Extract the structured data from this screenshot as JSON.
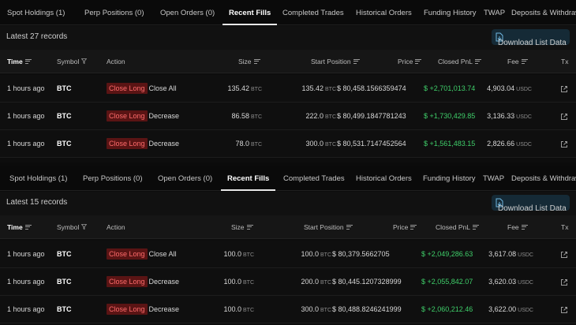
{
  "tabs": [
    "Spot Holdings (1)",
    "Perp Positions (0)",
    "Open Orders (0)",
    "Recent Fills",
    "Completed Trades",
    "Historical Orders",
    "Funding History",
    "TWAP",
    "Deposits & Withdraw"
  ],
  "active_tab": "Recent Fills",
  "download_label": "Download List Data",
  "columns": {
    "time": "Time",
    "symbol": "Symbol",
    "action": "Action",
    "size": "Size",
    "start_position": "Start Position",
    "price": "Price",
    "closed_pnl": "Closed PnL",
    "fee": "Fee",
    "tx": "Tx"
  },
  "panels": [
    {
      "records_label": "Latest 27 records",
      "rows": [
        {
          "time": "1 hours ago",
          "symbol": "BTC",
          "action_badge": "Close Long",
          "action_text": "Close All",
          "size": "135.42",
          "size_unit": "BTC",
          "start_position": "135.42",
          "start_unit": "BTC",
          "price": "$ 80,458.1566359474",
          "closed_pnl": "$ +2,701,013.74",
          "fee": "4,903.04",
          "fee_unit": "USDC"
        },
        {
          "time": "1 hours ago",
          "symbol": "BTC",
          "action_badge": "Close Long",
          "action_text": "Decrease",
          "size": "86.58",
          "size_unit": "BTC",
          "start_position": "222.0",
          "start_unit": "BTC",
          "price": "$ 80,499.1847781243",
          "closed_pnl": "$ +1,730,429.85",
          "fee": "3,136.33",
          "fee_unit": "USDC"
        },
        {
          "time": "1 hours ago",
          "symbol": "BTC",
          "action_badge": "Close Long",
          "action_text": "Decrease",
          "size": "78.0",
          "size_unit": "BTC",
          "start_position": "300.0",
          "start_unit": "BTC",
          "price": "$ 80,531.7147452564",
          "closed_pnl": "$ +1,561,483.15",
          "fee": "2,826.66",
          "fee_unit": "USDC"
        }
      ]
    },
    {
      "records_label": "Latest 15 records",
      "rows": [
        {
          "time": "1 hours ago",
          "symbol": "BTC",
          "action_badge": "Close Long",
          "action_text": "Close All",
          "size": "100.0",
          "size_unit": "BTC",
          "start_position": "100.0",
          "start_unit": "BTC",
          "price": "$ 80,379.5662705",
          "closed_pnl": "$ +2,049,286.63",
          "fee": "3,617.08",
          "fee_unit": "USDC"
        },
        {
          "time": "1 hours ago",
          "symbol": "BTC",
          "action_badge": "Close Long",
          "action_text": "Decrease",
          "size": "100.0",
          "size_unit": "BTC",
          "start_position": "200.0",
          "start_unit": "BTC",
          "price": "$ 80,445.1207328999",
          "closed_pnl": "$ +2,055,842.07",
          "fee": "3,620.03",
          "fee_unit": "USDC"
        },
        {
          "time": "1 hours ago",
          "symbol": "BTC",
          "action_badge": "Close Long",
          "action_text": "Decrease",
          "size": "100.0",
          "size_unit": "BTC",
          "start_position": "300.0",
          "start_unit": "BTC",
          "price": "$ 80,488.8246241999",
          "closed_pnl": "$ +2,060,212.46",
          "fee": "3,622.00",
          "fee_unit": "USDC"
        }
      ]
    }
  ]
}
